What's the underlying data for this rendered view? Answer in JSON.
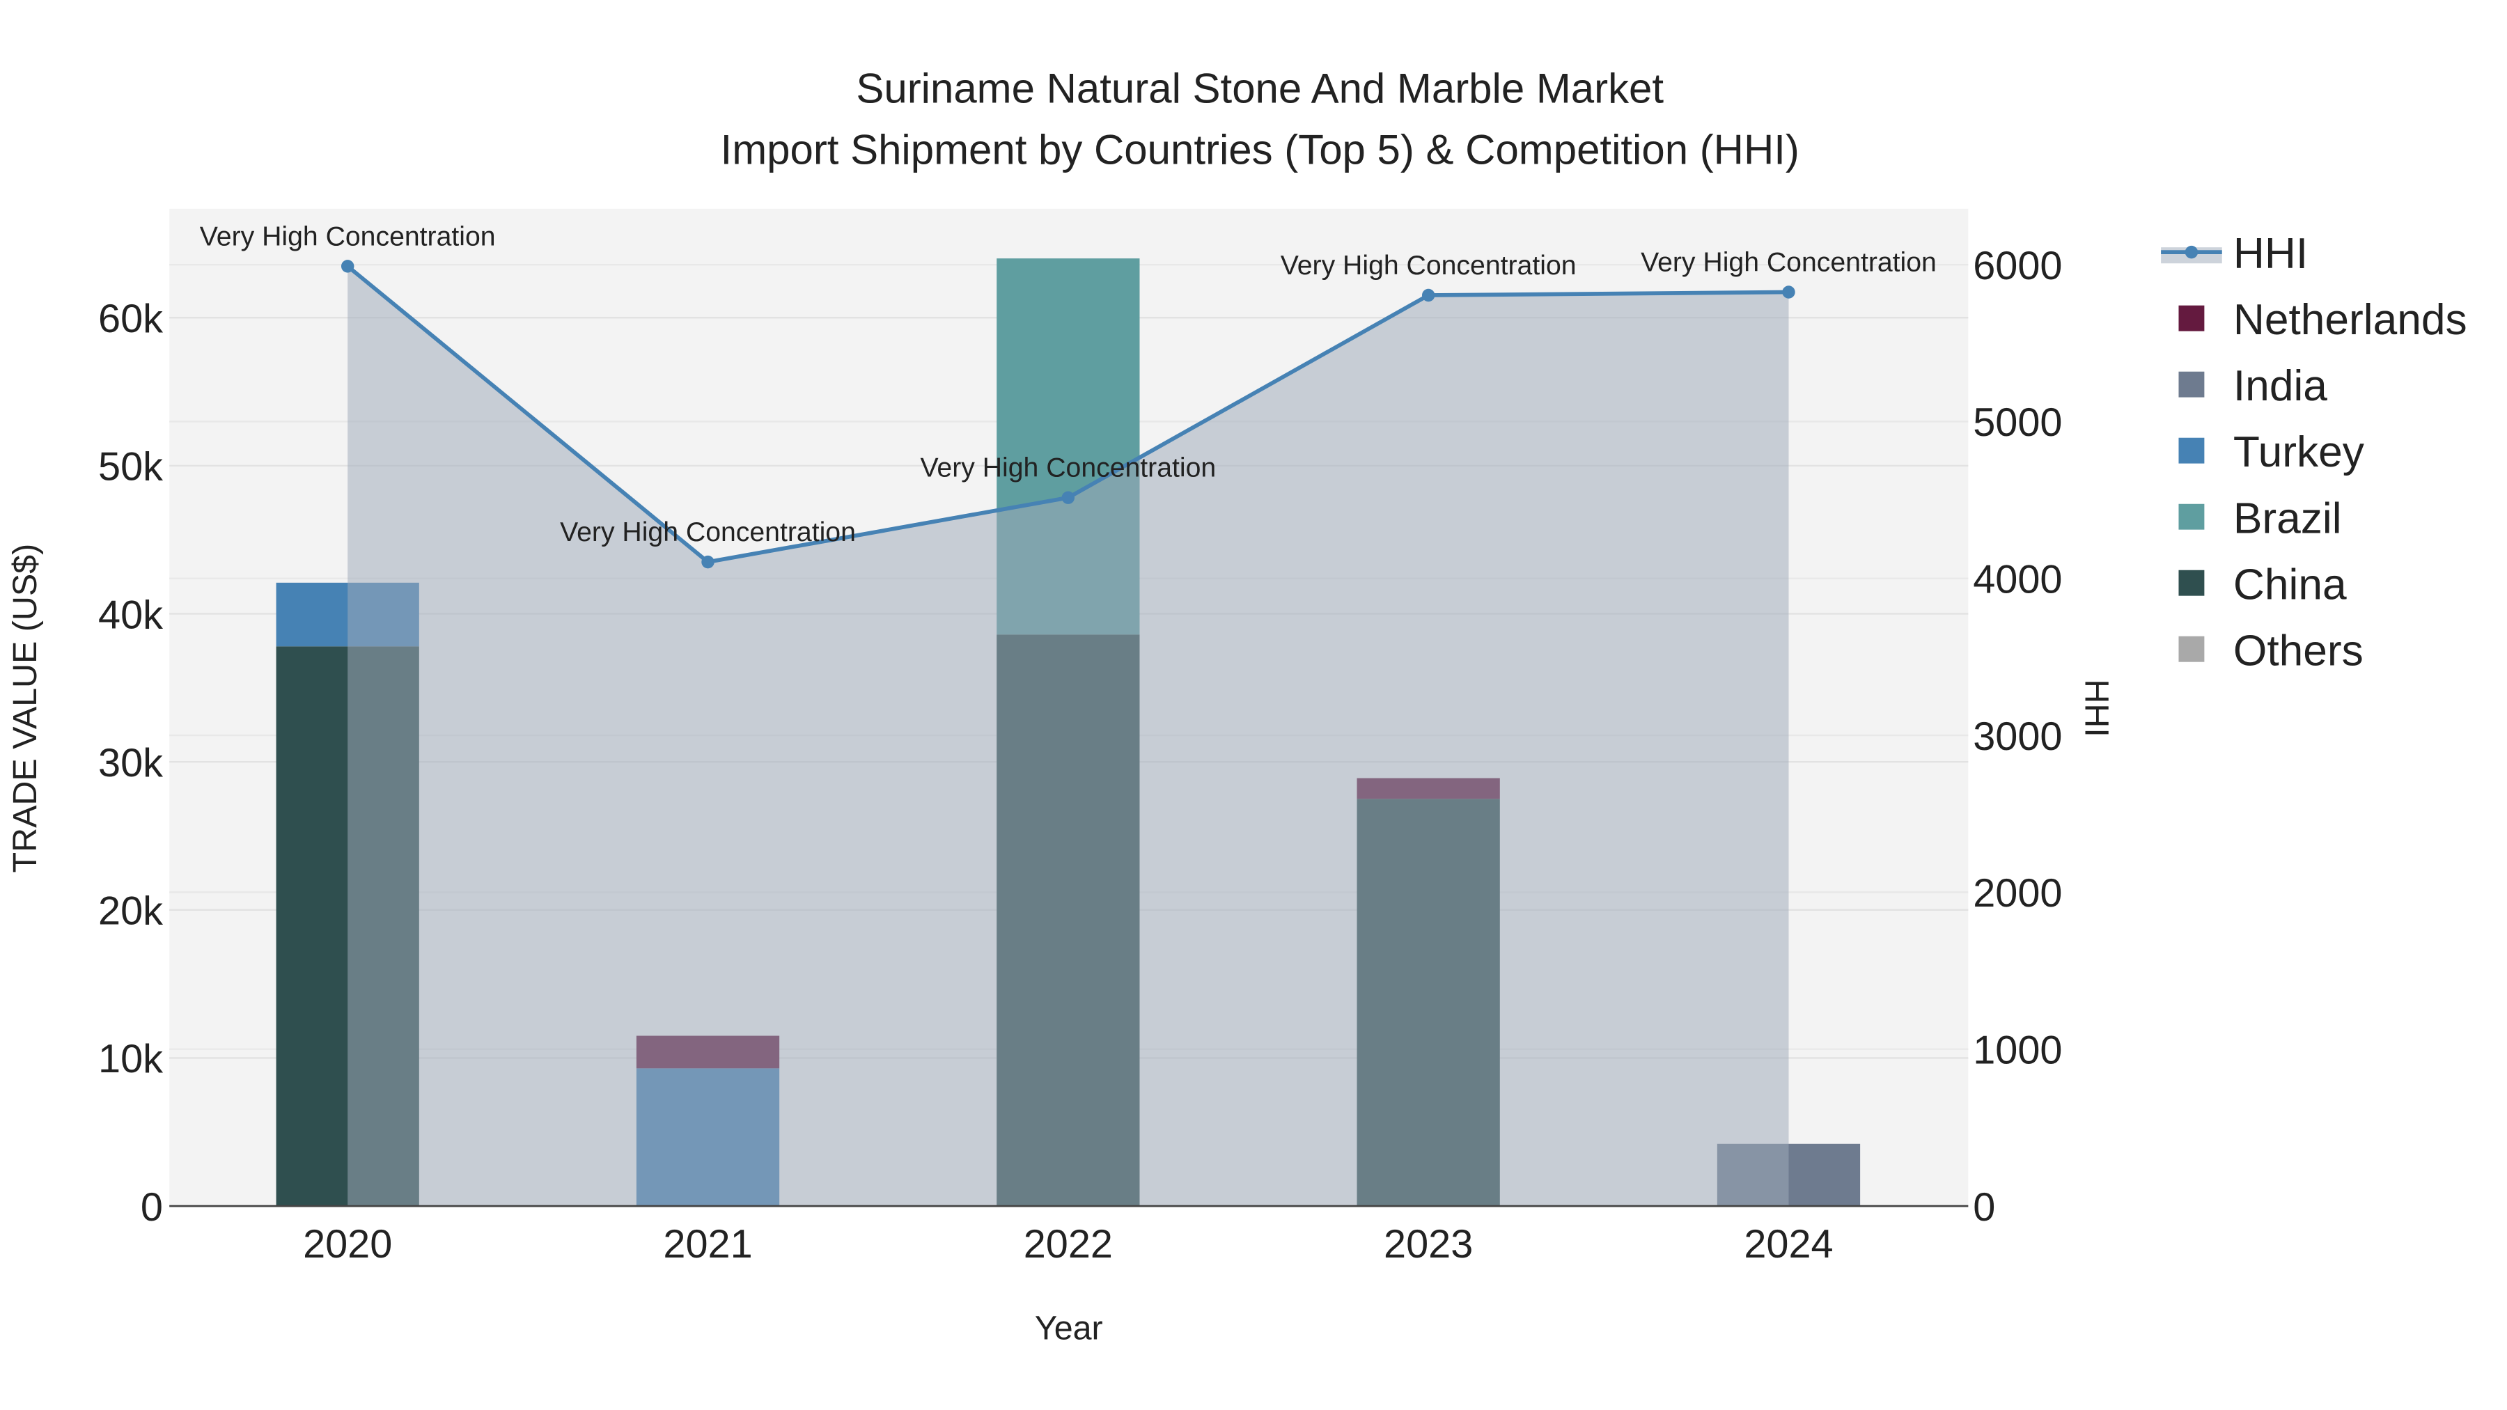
{
  "chart_data": {
    "type": "bar",
    "title": "Suriname Natural Stone And Marble Market",
    "subtitle": "Import Shipment by Countries (Top 5) & Competition (HHI)",
    "xlabel": "Year",
    "ylabel": "TRADE VALUE (US$)",
    "y2label": "HHI",
    "categories": [
      "2020",
      "2021",
      "2022",
      "2023",
      "2024"
    ],
    "ylim": [
      0,
      67000
    ],
    "y2lim": [
      0,
      6350
    ],
    "yticks": [
      0,
      10000,
      20000,
      30000,
      40000,
      50000,
      60000
    ],
    "ytick_labels": [
      "0",
      "10k",
      "20k",
      "30k",
      "40k",
      "50k",
      "60k"
    ],
    "y2ticks": [
      0,
      1000,
      2000,
      3000,
      4000,
      5000,
      6000
    ],
    "y2tick_labels": [
      "0",
      "1000",
      "2000",
      "3000",
      "4000",
      "5000",
      "6000"
    ],
    "stacked": true,
    "series": [
      {
        "name": "China",
        "color": "#2f4f4f",
        "values": [
          37800,
          0,
          38600,
          27500,
          0
        ]
      },
      {
        "name": "Brazil",
        "color": "#5f9ea0",
        "values": [
          0,
          0,
          25400,
          0,
          0
        ]
      },
      {
        "name": "Turkey",
        "color": "#4682b4",
        "values": [
          4300,
          9300,
          0,
          0,
          0
        ]
      },
      {
        "name": "India",
        "color": "#6e7b8f",
        "values": [
          0,
          0,
          0,
          0,
          4200
        ]
      },
      {
        "name": "Netherlands",
        "color": "#641a3f",
        "values": [
          0,
          2200,
          0,
          1400,
          0
        ]
      },
      {
        "name": "Others",
        "color": "#a9a9a9",
        "values": [
          0,
          0,
          0,
          0,
          0
        ]
      }
    ],
    "legend_order": [
      "HHI",
      "Netherlands",
      "India",
      "Turkey",
      "Brazil",
      "China",
      "Others"
    ],
    "hhi": {
      "name": "HHI",
      "color": "#4682b4",
      "values": [
        5990,
        4105,
        4515,
        5805,
        5825
      ],
      "annotations": [
        "Very High Concentration",
        "Very High Concentration",
        "Very High Concentration",
        "Very High Concentration",
        "Very High Concentration"
      ]
    },
    "legend_position": "right",
    "grid": true
  }
}
